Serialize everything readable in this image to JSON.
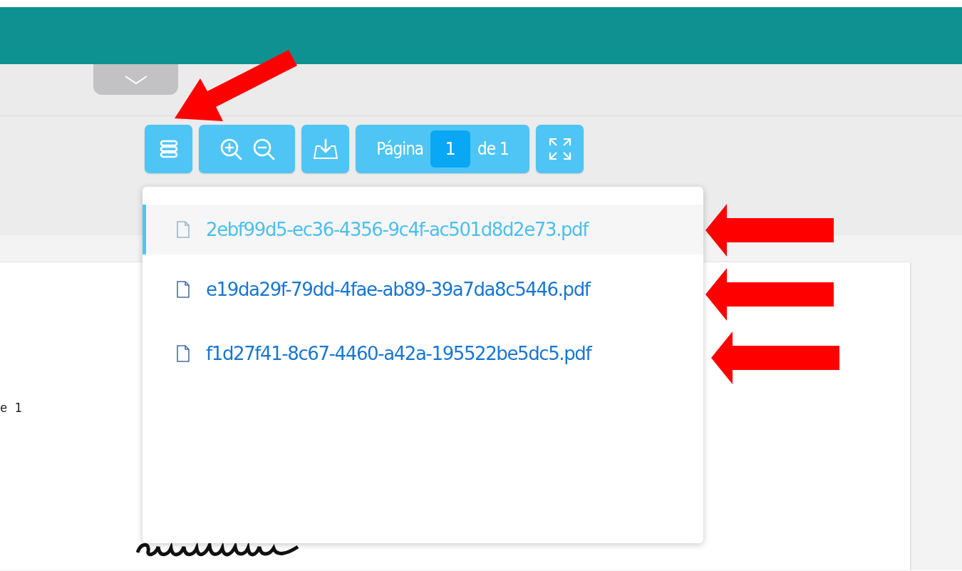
{
  "toolbar": {
    "buttons": [
      {
        "kind": "menu"
      },
      {
        "kind": "zoom"
      },
      {
        "kind": "download"
      },
      {
        "kind": "page",
        "label": "Página",
        "value": "1",
        "total": "de 1"
      },
      {
        "kind": "fullscreen"
      }
    ]
  },
  "files": [
    {
      "name": "2ebf99d5-ec36-4356-9c4f-ac501d8d2e73.pdf",
      "selected": true
    },
    {
      "name": "e19da29f-79dd-4fae-ab89-39a7da8c5446.pdf",
      "selected": false
    },
    {
      "name": "f1d27f41-8c67-4460-a42a-195522be5dc5.pdf",
      "selected": false
    }
  ],
  "document": {
    "text": "e 1"
  }
}
